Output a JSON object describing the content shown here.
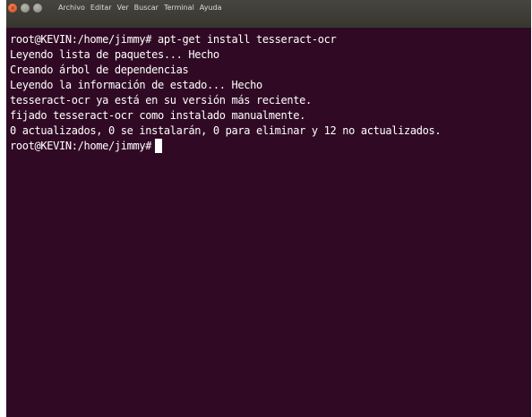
{
  "window": {
    "buttons": {
      "close": "×",
      "minimize": "",
      "maximize": ""
    },
    "menu": [
      "Archivo",
      "Editar",
      "Ver",
      "Buscar",
      "Terminal",
      "Ayuda"
    ]
  },
  "terminal": {
    "lines": [
      "root@KEVIN:/home/jimmy# apt-get install tesseract-ocr",
      "Leyendo lista de paquetes... Hecho",
      "Creando árbol de dependencias",
      "Leyendo la información de estado... Hecho",
      "tesseract-ocr ya está en su versión más reciente.",
      "fijado tesseract-ocr como instalado manualmente.",
      "0 actualizados, 0 se instalarán, 0 para eliminar y 12 no actualizados."
    ],
    "prompt": "root@KEVIN:/home/jimmy#"
  },
  "colors": {
    "terminal_background": "#300a24",
    "terminal_text": "#ffffff",
    "titlebar": "#3c3b37",
    "close_button": "#e95420"
  }
}
